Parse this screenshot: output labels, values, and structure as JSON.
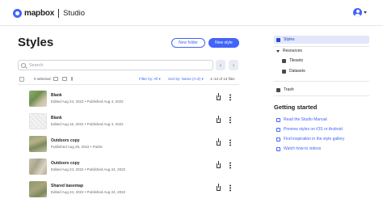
{
  "app": {
    "brand": "mapbox",
    "section": "Studio"
  },
  "page": {
    "title": "Styles"
  },
  "actions": {
    "new_folder": "New folder",
    "new_style": "New style"
  },
  "search": {
    "placeholder": "Search"
  },
  "toolbar": {
    "selected": "0 selected",
    "filter": "Filter by: All ▾",
    "sort": "Sort by: Name (A-Z) ▾",
    "range": "1–13 of 13 files"
  },
  "styles": [
    {
      "name": "Blank",
      "meta": "Edited Aug 24, 2022 • Published Aug 4, 2022",
      "thumb": "terrain-green"
    },
    {
      "name": "Blank",
      "meta": "Edited Aug 16, 2022 • Published Aug 4, 2022",
      "thumb": "blank"
    },
    {
      "name": "Outdoors copy",
      "meta": "Published Aug 25, 2022 • Public",
      "thumb": "satellite"
    },
    {
      "name": "Outdoors copy",
      "meta": "Edited Aug 24, 2022 • Published Aug 24, 2022",
      "thumb": "terrain-brown"
    },
    {
      "name": "Shared basemap",
      "meta": "Edited Aug 24, 2022 • Published Aug 24, 2022",
      "thumb": "terrain-green"
    }
  ],
  "sidebar": {
    "items": [
      {
        "label": "Styles",
        "icon": "styles-icon",
        "active": true
      },
      {
        "label": "Resources",
        "icon": "caret-down-icon"
      },
      {
        "label": "Tilesets",
        "icon": "tilesets-icon"
      },
      {
        "label": "Datasets",
        "icon": "datasets-icon"
      },
      {
        "label": "Trash",
        "icon": "trash-icon"
      }
    ]
  },
  "getting_started": {
    "title": "Getting started",
    "links": [
      "Read the Studio Manual",
      "Preview styles on iOS or Android",
      "Find inspiration in the style gallery",
      "Watch how-to videos"
    ]
  },
  "colors": {
    "accent": "#4264fb",
    "active_bg": "#e2e7fb"
  }
}
